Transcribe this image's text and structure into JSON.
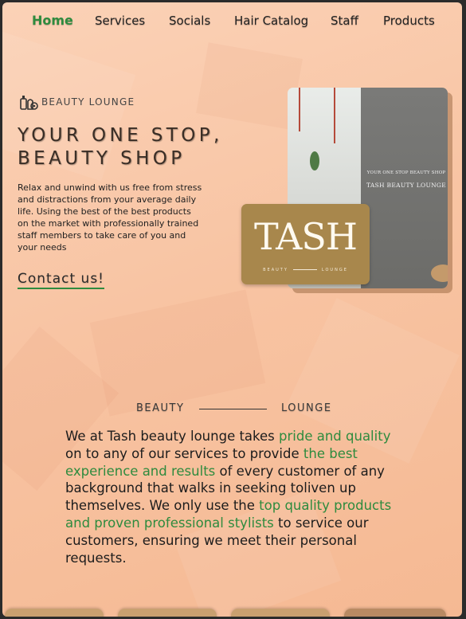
{
  "nav": {
    "items": [
      {
        "label": "Home",
        "active": true
      },
      {
        "label": "Services",
        "active": false
      },
      {
        "label": "Socials",
        "active": false
      },
      {
        "label": "Hair Catalog",
        "active": false
      },
      {
        "label": "Staff",
        "active": false
      },
      {
        "label": "Products",
        "active": false
      }
    ]
  },
  "hero": {
    "brand_icon": "salon-products-icon",
    "brand_label": "BEAUTY LOUNGE",
    "headline_line1": "YOUR ONE STOP,",
    "headline_line2": "BEAUTY SHOP",
    "description": "Relax and unwind with us free from stress and distractions from your average daily life. Using the best of the best products on the market with professionally trained staff members to take care of you and your needs",
    "cta_label": "Contact us!"
  },
  "photo": {
    "sign_line1": "YOUR ONE STOP BEAUTY SHOP",
    "sign_line2": "TASH BEAUTY LOUNGE"
  },
  "logo": {
    "word": "TASH",
    "sub_left": "BEAUTY",
    "sub_right": "LOUNGE"
  },
  "about": {
    "divider_left": "BEAUTY",
    "divider_right": "LOUNGE",
    "p1": "We at Tash beauty lounge takes ",
    "h1": "pride and quality",
    "p2": " on to any of our services to provide ",
    "h2": "the best experience and results",
    "p3": " of every customer of any background that walks in seeking toliven up themselves. We only use the ",
    "h3": "top quality products and proven professional stylists",
    "p4": " to service our customers, ensuring we meet their personal requests."
  },
  "colors": {
    "accent": "#2e8b3e",
    "logo_card": "#a8874c",
    "background": "#f8c4a3"
  }
}
